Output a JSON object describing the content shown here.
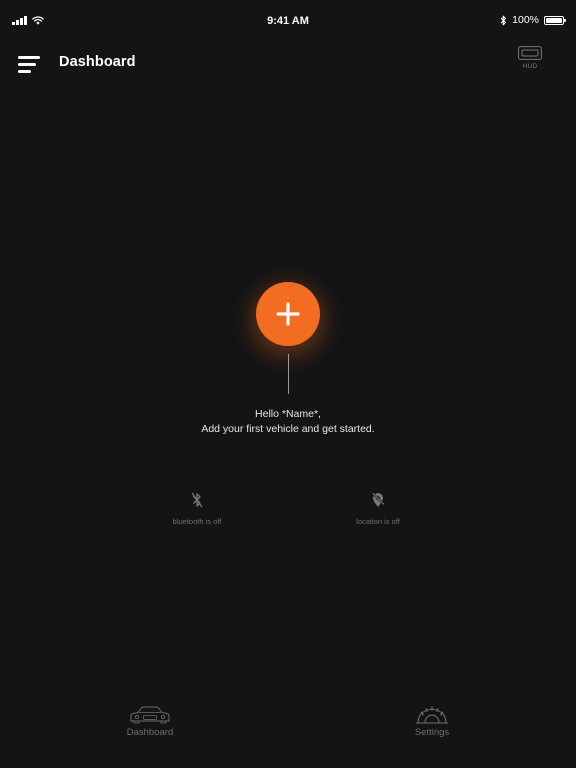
{
  "status_bar": {
    "time": "9:41 AM",
    "battery": "100%",
    "battery_level": 1.0,
    "signal_bars": 4
  },
  "header": {
    "title": "Dashboard",
    "hud_label": "HUD"
  },
  "main": {
    "greeting_line1": "Hello *Name*,",
    "greeting_line2": "Add your first vehicle and get started."
  },
  "status_items": {
    "bluetooth": "bluetooth is off",
    "location": "location is off"
  },
  "tab_bar": {
    "dashboard": "Dashboard",
    "settings": "Settings"
  },
  "colors": {
    "background": "#141414",
    "accent": "#f26d21",
    "muted_text": "#6e6e6e"
  },
  "icons": {
    "menu": "hamburger-menu-icon",
    "hud": "hud-display-icon",
    "add": "plus-icon",
    "bluetooth": "bluetooth-off-icon",
    "location": "location-off-icon",
    "dashboard_tab": "car-icon",
    "settings_tab": "gauge-icon"
  }
}
